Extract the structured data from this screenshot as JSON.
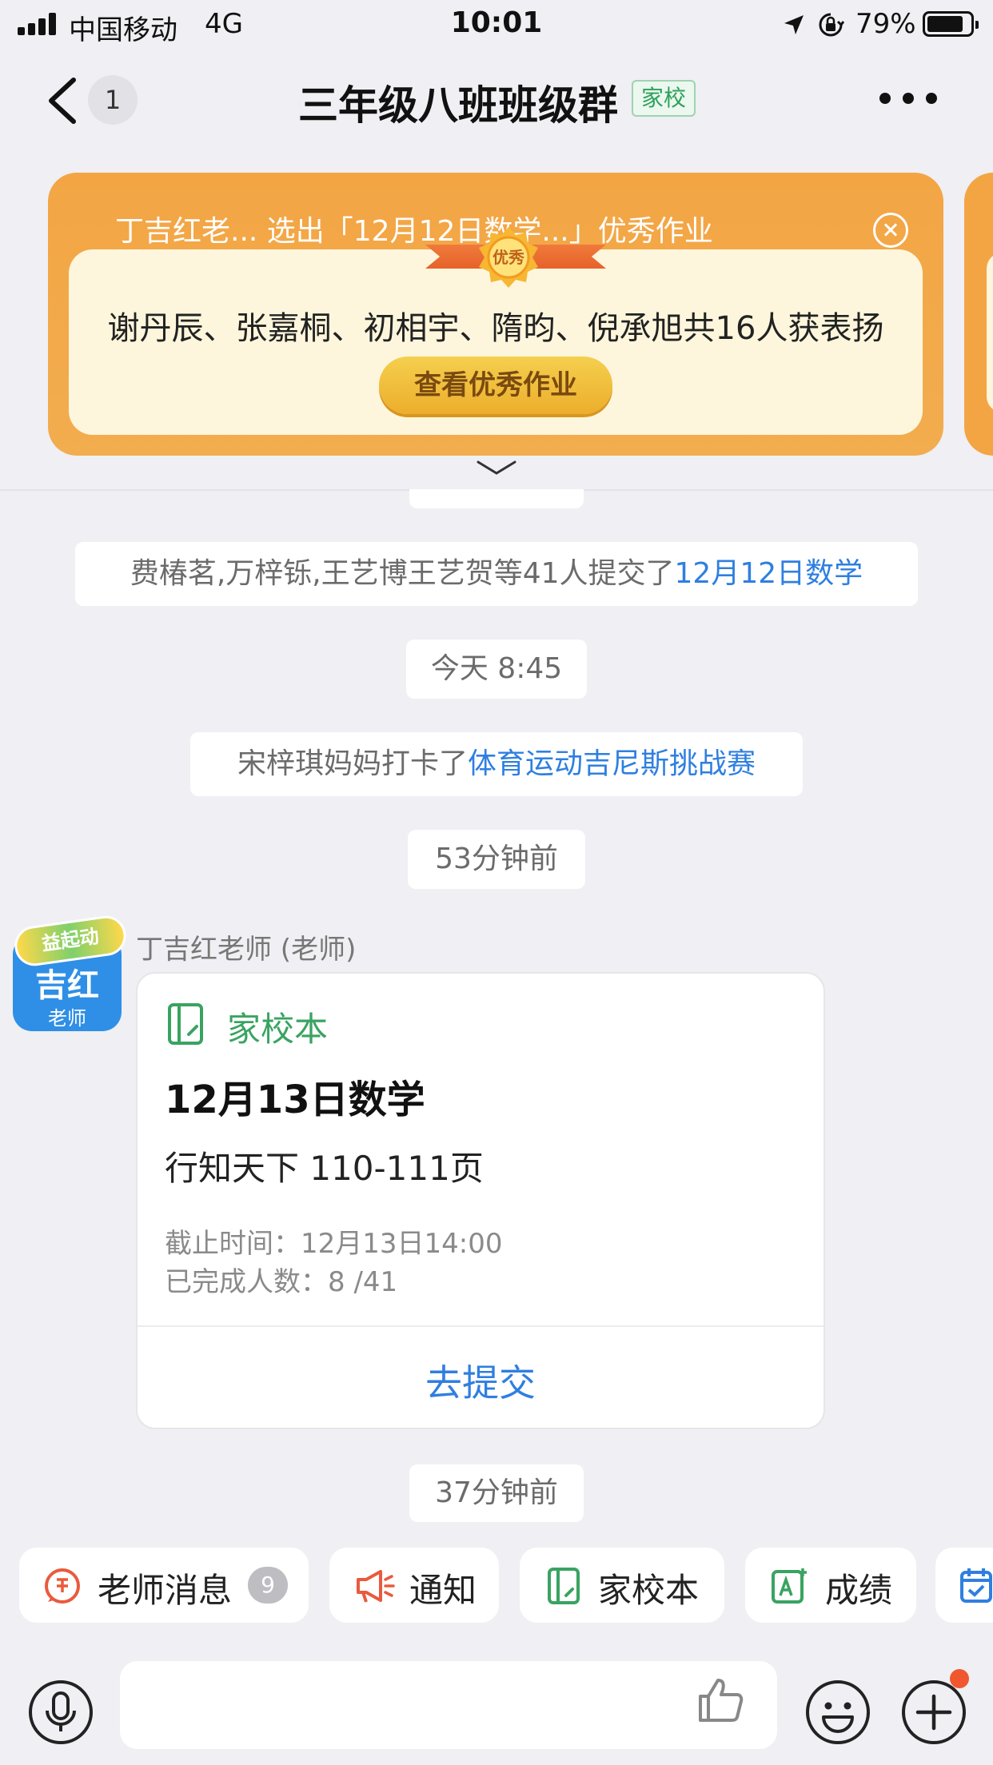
{
  "status_bar": {
    "carrier": "中国移动",
    "network": "4G",
    "time": "10:01",
    "battery_percent": "79%",
    "battery_level": 0.79
  },
  "nav": {
    "back_icon": "chevron-left-icon",
    "unread_count": "1",
    "title": "三年级八班班级群",
    "tag": "家校",
    "more_icon": "more-horizontal-icon"
  },
  "banner": {
    "header": "丁吉红老... 选出「12月12日数学...」优秀作业",
    "medal_label": "优秀",
    "names_line": "谢丹辰、张嘉桐、初相宇、隋昀、倪承旭共16人获表扬",
    "button_label": "查看优秀作业",
    "close_icon": "close-circle-icon",
    "expand_icon": "chevron-down-icon"
  },
  "chat": {
    "submit_notice": {
      "text": "费椿茗,万梓铄,王艺博王艺贺等41人提交了",
      "link": "12月12日数学"
    },
    "time_1": "今天 8:45",
    "checkin_notice": {
      "text": "宋梓琪妈妈打卡了",
      "link": "体育运动吉尼斯挑战赛"
    },
    "time_2": "53分钟前",
    "message": {
      "avatar_name": "吉红",
      "avatar_role": "老师",
      "avatar_badge": "益起动",
      "sender": "丁吉红老师 (老师)",
      "app_name": "家校本",
      "app_icon": "notebook-icon",
      "title": "12月13日数学",
      "content": "行知天下 110-111页",
      "deadline": "截止时间：12月13日14:00",
      "completed": "已完成人数：8 /41",
      "action": "去提交"
    },
    "time_3": "37分钟前"
  },
  "quick_actions": [
    {
      "label": "老师消息",
      "icon": "teacher-icon",
      "count": "9"
    },
    {
      "label": "通知",
      "icon": "megaphone-icon"
    },
    {
      "label": "家校本",
      "icon": "notebook-icon"
    },
    {
      "label": "成绩",
      "icon": "grade-icon"
    },
    {
      "label": "",
      "icon": "calendar-check-icon"
    }
  ],
  "input_bar": {
    "voice_icon": "microphone-icon",
    "input_value": "",
    "like_icon": "thumbs-up-icon",
    "emoji_icon": "smile-icon",
    "plus_icon": "plus-icon"
  },
  "colors": {
    "banner_orange": "#f3a544",
    "link_blue": "#2f7fe0",
    "app_green": "#3aa361",
    "badge_red": "#f0572e"
  }
}
